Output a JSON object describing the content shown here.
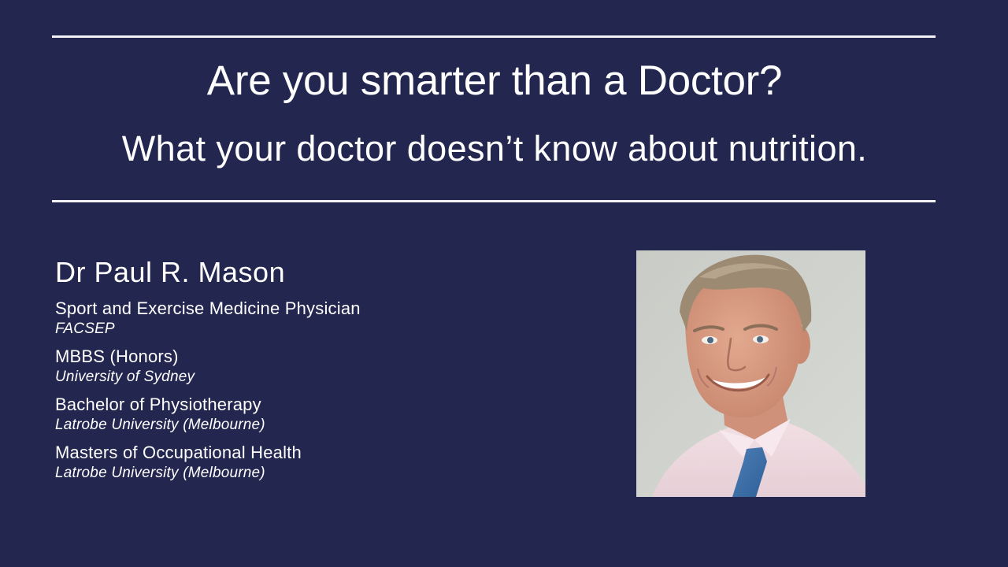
{
  "slide": {
    "title": "Are you smarter than a Doctor?",
    "subtitle": "What your doctor doesn’t know about nutrition."
  },
  "presenter": {
    "name": "Dr Paul R. Mason",
    "credentials": [
      {
        "role": "Sport and Exercise Medicine Physician",
        "institution": "FACSEP"
      },
      {
        "role": "MBBS (Honors)",
        "institution": "University of Sydney"
      },
      {
        "role": "Bachelor of Physiotherapy",
        "institution": "Latrobe University (Melbourne)"
      },
      {
        "role": "Masters of Occupational Health",
        "institution": "Latrobe University (Melbourne)"
      }
    ]
  },
  "colors": {
    "background": "#23264f",
    "text": "#ffffff",
    "rule": "#f2f2f5"
  }
}
